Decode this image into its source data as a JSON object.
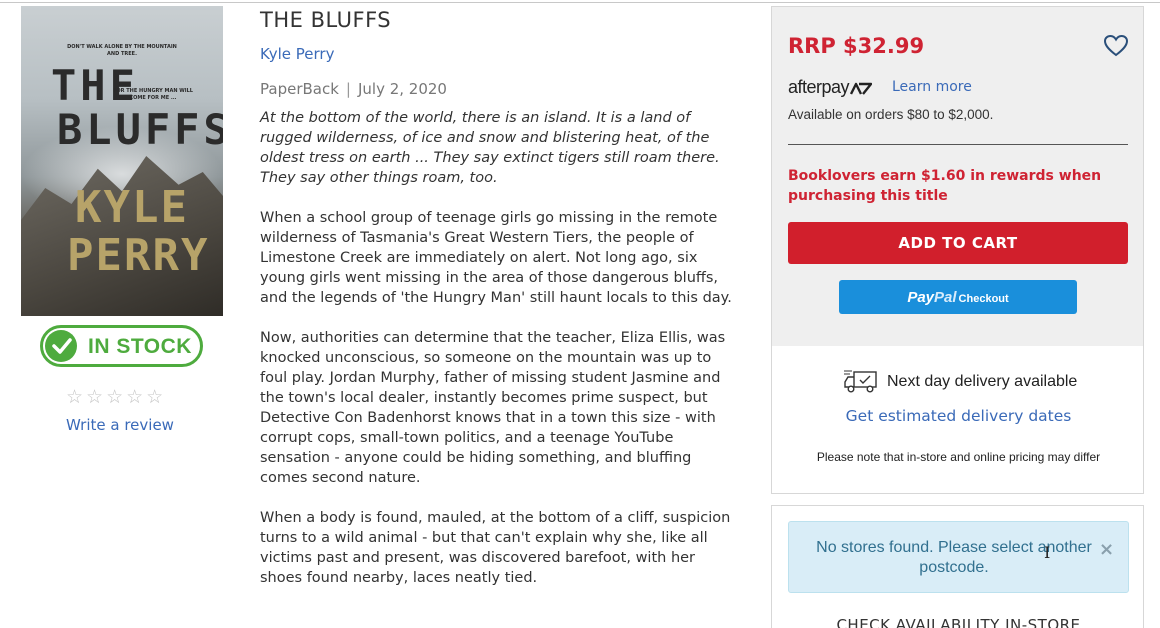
{
  "product": {
    "cover": {
      "tagline_top": "DON'T WALK ALONE BY THE MOUNTAIN AND TREE.",
      "tagline_mid": "FOR THE HUNGRY MAN WILL COME FOR ME ...",
      "title_line1": "THE",
      "title_line2": "BLUFFS",
      "author_line1": "KYLE",
      "author_line2": "PERRY"
    },
    "title": "THE BLUFFS",
    "author": "Kyle Perry",
    "format": "PaperBack",
    "separator": "|",
    "date": "July 2, 2020",
    "stock_label": "IN STOCK",
    "rating": {
      "stars": "☆☆☆☆☆",
      "value": 0,
      "max": 5
    },
    "review_link": "Write a review",
    "description": [
      "At the bottom of the world, there is an island. It is a land of rugged wilderness, of ice and snow and blistering heat, of the oldest tress on earth ... They say extinct tigers still roam there. They say other things roam, too.",
      "When a school group of teenage girls go missing in the remote wilderness of Tasmania's Great Western Tiers, the people of Limestone Creek are immediately on alert. Not long ago, six young girls went missing in the area of those dangerous bluffs, and the legends of 'the Hungry Man' still haunt locals to this day.",
      "Now, authorities can determine that the teacher, Eliza Ellis, was knocked unconscious, so someone on the mountain was up to foul play. Jordan Murphy, father of missing student Jasmine and the town's local dealer, instantly becomes prime suspect, but Detective Con Badenhorst knows that in a town this size - with corrupt cops, small-town politics, and a teenage YouTube sensation - anyone could be hiding something, and bluffing comes second nature.",
      "When a body is found, mauled, at the bottom of a cliff, suspicion turns to a wild animal - but that can't explain why she, like all victims past and present, was discovered barefoot, with her shoes found nearby, laces neatly tied."
    ]
  },
  "purchase": {
    "price": "RRP $32.99",
    "afterpay_brand": "afterpay",
    "afterpay_learn": "Learn more",
    "afterpay_range": "Available on orders $80 to $2,000.",
    "rewards": "Booklovers earn $1.60 in rewards when purchasing this title",
    "add_to_cart": "ADD TO CART",
    "paypal_brand_1": "Pay",
    "paypal_brand_2": "Pal",
    "paypal_checkout": "Checkout"
  },
  "delivery": {
    "next_day": "Next day delivery available",
    "estimate_link": "Get estimated delivery dates",
    "pricing_note": "Please note that in-store and online pricing may differ"
  },
  "stores": {
    "alert": "No stores found. Please select another postcode.",
    "close": "×",
    "check_availability": "CHECK AVAILABILITY IN-STORE"
  },
  "colors": {
    "brand_red": "#cf2333",
    "link_blue": "#3a6ab8",
    "stock_green": "#4eab3e",
    "paypal_blue": "#1a8fdb",
    "alert_bg": "#d9edf7"
  }
}
